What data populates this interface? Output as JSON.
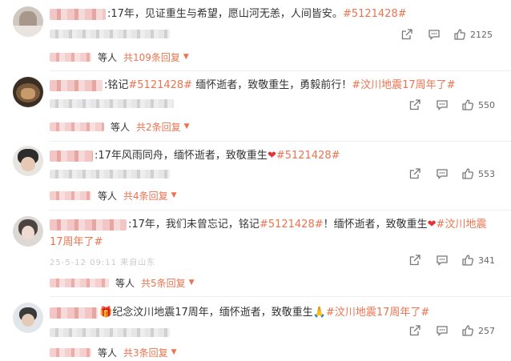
{
  "comments": [
    {
      "text": ":17年，见证重生与希望，愿山河无恙，人间皆安。",
      "tags": [
        "#5121428#"
      ],
      "like_count": "2125",
      "reply_suffix": "等人",
      "reply_link": "共109条回复"
    },
    {
      "text": ":铭记",
      "tag_inline": "#5121428#",
      "text2": " 缅怀逝者，致敬重生，勇毅前行！",
      "tag2": "#汶川地震17周年了#",
      "like_count": "550",
      "reply_suffix": "等人",
      "reply_link": "共2条回复"
    },
    {
      "text": ":17年风雨同舟，缅怀逝者，致敬重生",
      "tag_inline": "#5121428#",
      "like_count": "553",
      "reply_suffix": "等人",
      "reply_link": "共4条回复"
    },
    {
      "text": ":17年，我们未曾忘记，铭记",
      "tag_inline": "#5121428#",
      "text2": "！缅怀逝者，致敬重生",
      "tag2": "#汶川地震",
      "tag3": "17周年了#",
      "meta_text": "25-5-12 09:11 来自山东",
      "like_count": "341",
      "reply_suffix": "等人",
      "reply_link": "共5条回复"
    },
    {
      "text": "纪念汶川地震17周年，缅怀逝者，致敬重生",
      "tag_inline": "#汶川地震17周年了#",
      "like_count": "257",
      "reply_suffix": "等人",
      "reply_link": "共3条回复"
    }
  ],
  "icons": {
    "share": "share-icon",
    "comment": "comment-icon",
    "like": "thumbs-up-icon",
    "chevron": "chevron-down-icon",
    "heart": "heart-emoji",
    "pray": "pray-emoji",
    "gift": "gift-emoji"
  },
  "colors": {
    "tag": "#eb7350",
    "reply_link": "#eb7350",
    "text": "#333333"
  }
}
